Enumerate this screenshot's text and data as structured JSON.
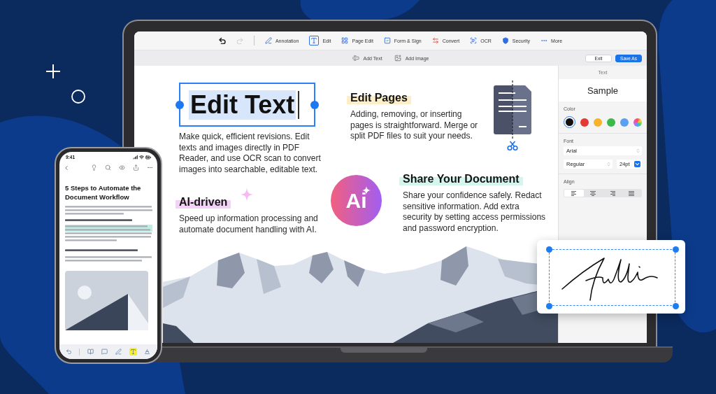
{
  "laptop": {
    "toolbar": {
      "history": [
        {
          "kind": "undo",
          "disabled": false
        },
        {
          "kind": "redo",
          "disabled": true
        }
      ],
      "tabs": [
        {
          "kind": "annotation",
          "label": "Annotation",
          "selected": false
        },
        {
          "kind": "edit",
          "label": "Edit",
          "selected": true
        },
        {
          "kind": "page_edit",
          "label": "Page Edit",
          "selected": false
        },
        {
          "kind": "form_sign",
          "label": "Form & Sign",
          "selected": false
        },
        {
          "kind": "convert",
          "label": "Convert",
          "selected": false
        },
        {
          "kind": "ocr",
          "label": "OCR",
          "selected": false
        },
        {
          "kind": "security",
          "label": "Security",
          "selected": false
        },
        {
          "kind": "more",
          "label": "More",
          "selected": false
        }
      ]
    },
    "subtoolbar": {
      "tools": [
        {
          "kind": "add_text",
          "label": "Add Text"
        },
        {
          "kind": "add_image",
          "label": "Add Image"
        }
      ],
      "buttons": [
        {
          "kind": "secondary",
          "label": "Exit"
        },
        {
          "kind": "primary",
          "label": "Save As"
        }
      ]
    },
    "document": {
      "features": [
        {
          "kind": "text_box",
          "title": "Edit Text",
          "color": "#d7e6fb",
          "lines": [
            "Make quick, efficient revisions. Edit",
            "texts and images directly in PDF",
            "Reader, and use OCR scan to convert",
            "images into searchable, editable text."
          ]
        },
        {
          "kind": "highlight",
          "title": "Edit Pages",
          "color": "#fcefc8",
          "lines": [
            "Adding, removing, or inserting",
            "pages is straightforward. Merge or",
            "split PDF files to suit your needs."
          ]
        },
        {
          "kind": "highlight",
          "title": "AI-driven",
          "color": "#f3d2f7",
          "lines": [
            "Speed up information processing and",
            "automate document handling with AI."
          ]
        },
        {
          "kind": "highlight",
          "title": "Share Your Document",
          "color": "#d4f6ef",
          "lines": [
            "Share your confidence safely. Redact",
            "sensitive information. Add extra",
            "security by setting access permissions",
            "and password encryption."
          ]
        }
      ],
      "ai_badge": "Ai"
    },
    "inspector": {
      "title": "Text",
      "preview": "Sample",
      "color_label": "Color",
      "colors": [
        {
          "kind": "swatch",
          "color": "#111111",
          "selected": true
        },
        {
          "kind": "swatch",
          "color": "#e53935",
          "selected": false
        },
        {
          "kind": "swatch",
          "color": "#f8b22c",
          "selected": false
        },
        {
          "kind": "swatch",
          "color": "#3cb94a",
          "selected": false
        },
        {
          "kind": "swatch",
          "color": "#5b9ff3",
          "selected": false
        },
        {
          "kind": "picker",
          "selected": false
        }
      ],
      "font_label": "Font",
      "font": "Arial",
      "style": "Regular",
      "size": "24pt",
      "align_label": "Align",
      "align": [
        {
          "kind": "left",
          "selected": true
        },
        {
          "kind": "center",
          "selected": false
        },
        {
          "kind": "right",
          "selected": false
        },
        {
          "kind": "justify",
          "selected": false
        }
      ]
    }
  },
  "phone": {
    "time": "9:41",
    "article": {
      "title": "5 Steps to Automate the Document Workflow"
    },
    "toolbar": [
      {
        "kind": "undo",
        "selected": false
      },
      {
        "kind": "read",
        "selected": false
      },
      {
        "kind": "comment",
        "selected": false
      },
      {
        "kind": "sign",
        "selected": false
      },
      {
        "kind": "highlight",
        "selected": true
      },
      {
        "kind": "underline",
        "selected": false
      }
    ]
  }
}
